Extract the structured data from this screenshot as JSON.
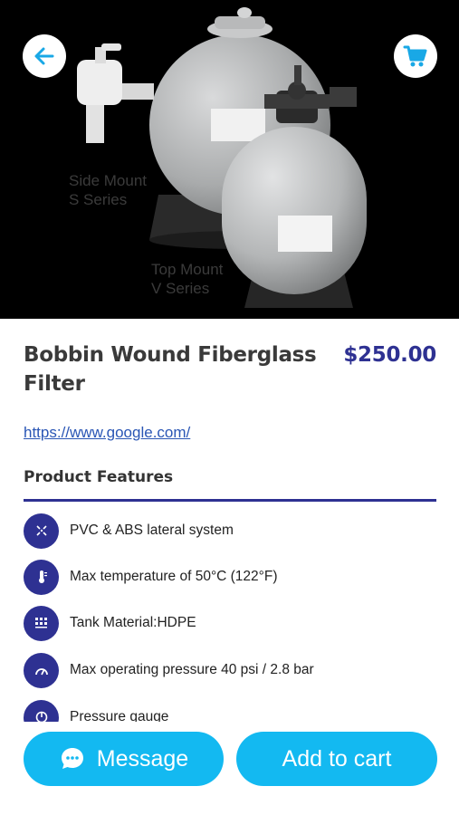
{
  "hero": {
    "caption_side_line1": "Side Mount",
    "caption_side_line2": "S Series",
    "caption_top_line1": "Top Mount",
    "caption_top_line2": "V Series"
  },
  "header": {
    "back_icon": "arrow-left-icon",
    "cart_icon": "shopping-cart-icon"
  },
  "product": {
    "title": "Bobbin Wound Fiberglass Filter",
    "price": "$250.00",
    "link": "https://www.google.com/"
  },
  "features": {
    "heading": "Product Features",
    "items": [
      {
        "icon": "lateral-system-icon",
        "label": "PVC & ABS lateral system"
      },
      {
        "icon": "thermometer-icon",
        "label": "Max temperature of 50°C (122°F)"
      },
      {
        "icon": "material-grid-icon",
        "label": "Tank Material:HDPE"
      },
      {
        "icon": "gauge-icon",
        "label": "Max operating pressure 40 psi / 2.8 bar"
      },
      {
        "icon": "pressure-gauge-icon",
        "label": "Pressure gauge"
      }
    ]
  },
  "actions": {
    "message_label": "Message",
    "add_to_cart_label": "Add to cart"
  },
  "colors": {
    "accent": "#2e3192",
    "button": "#13b9f1"
  }
}
